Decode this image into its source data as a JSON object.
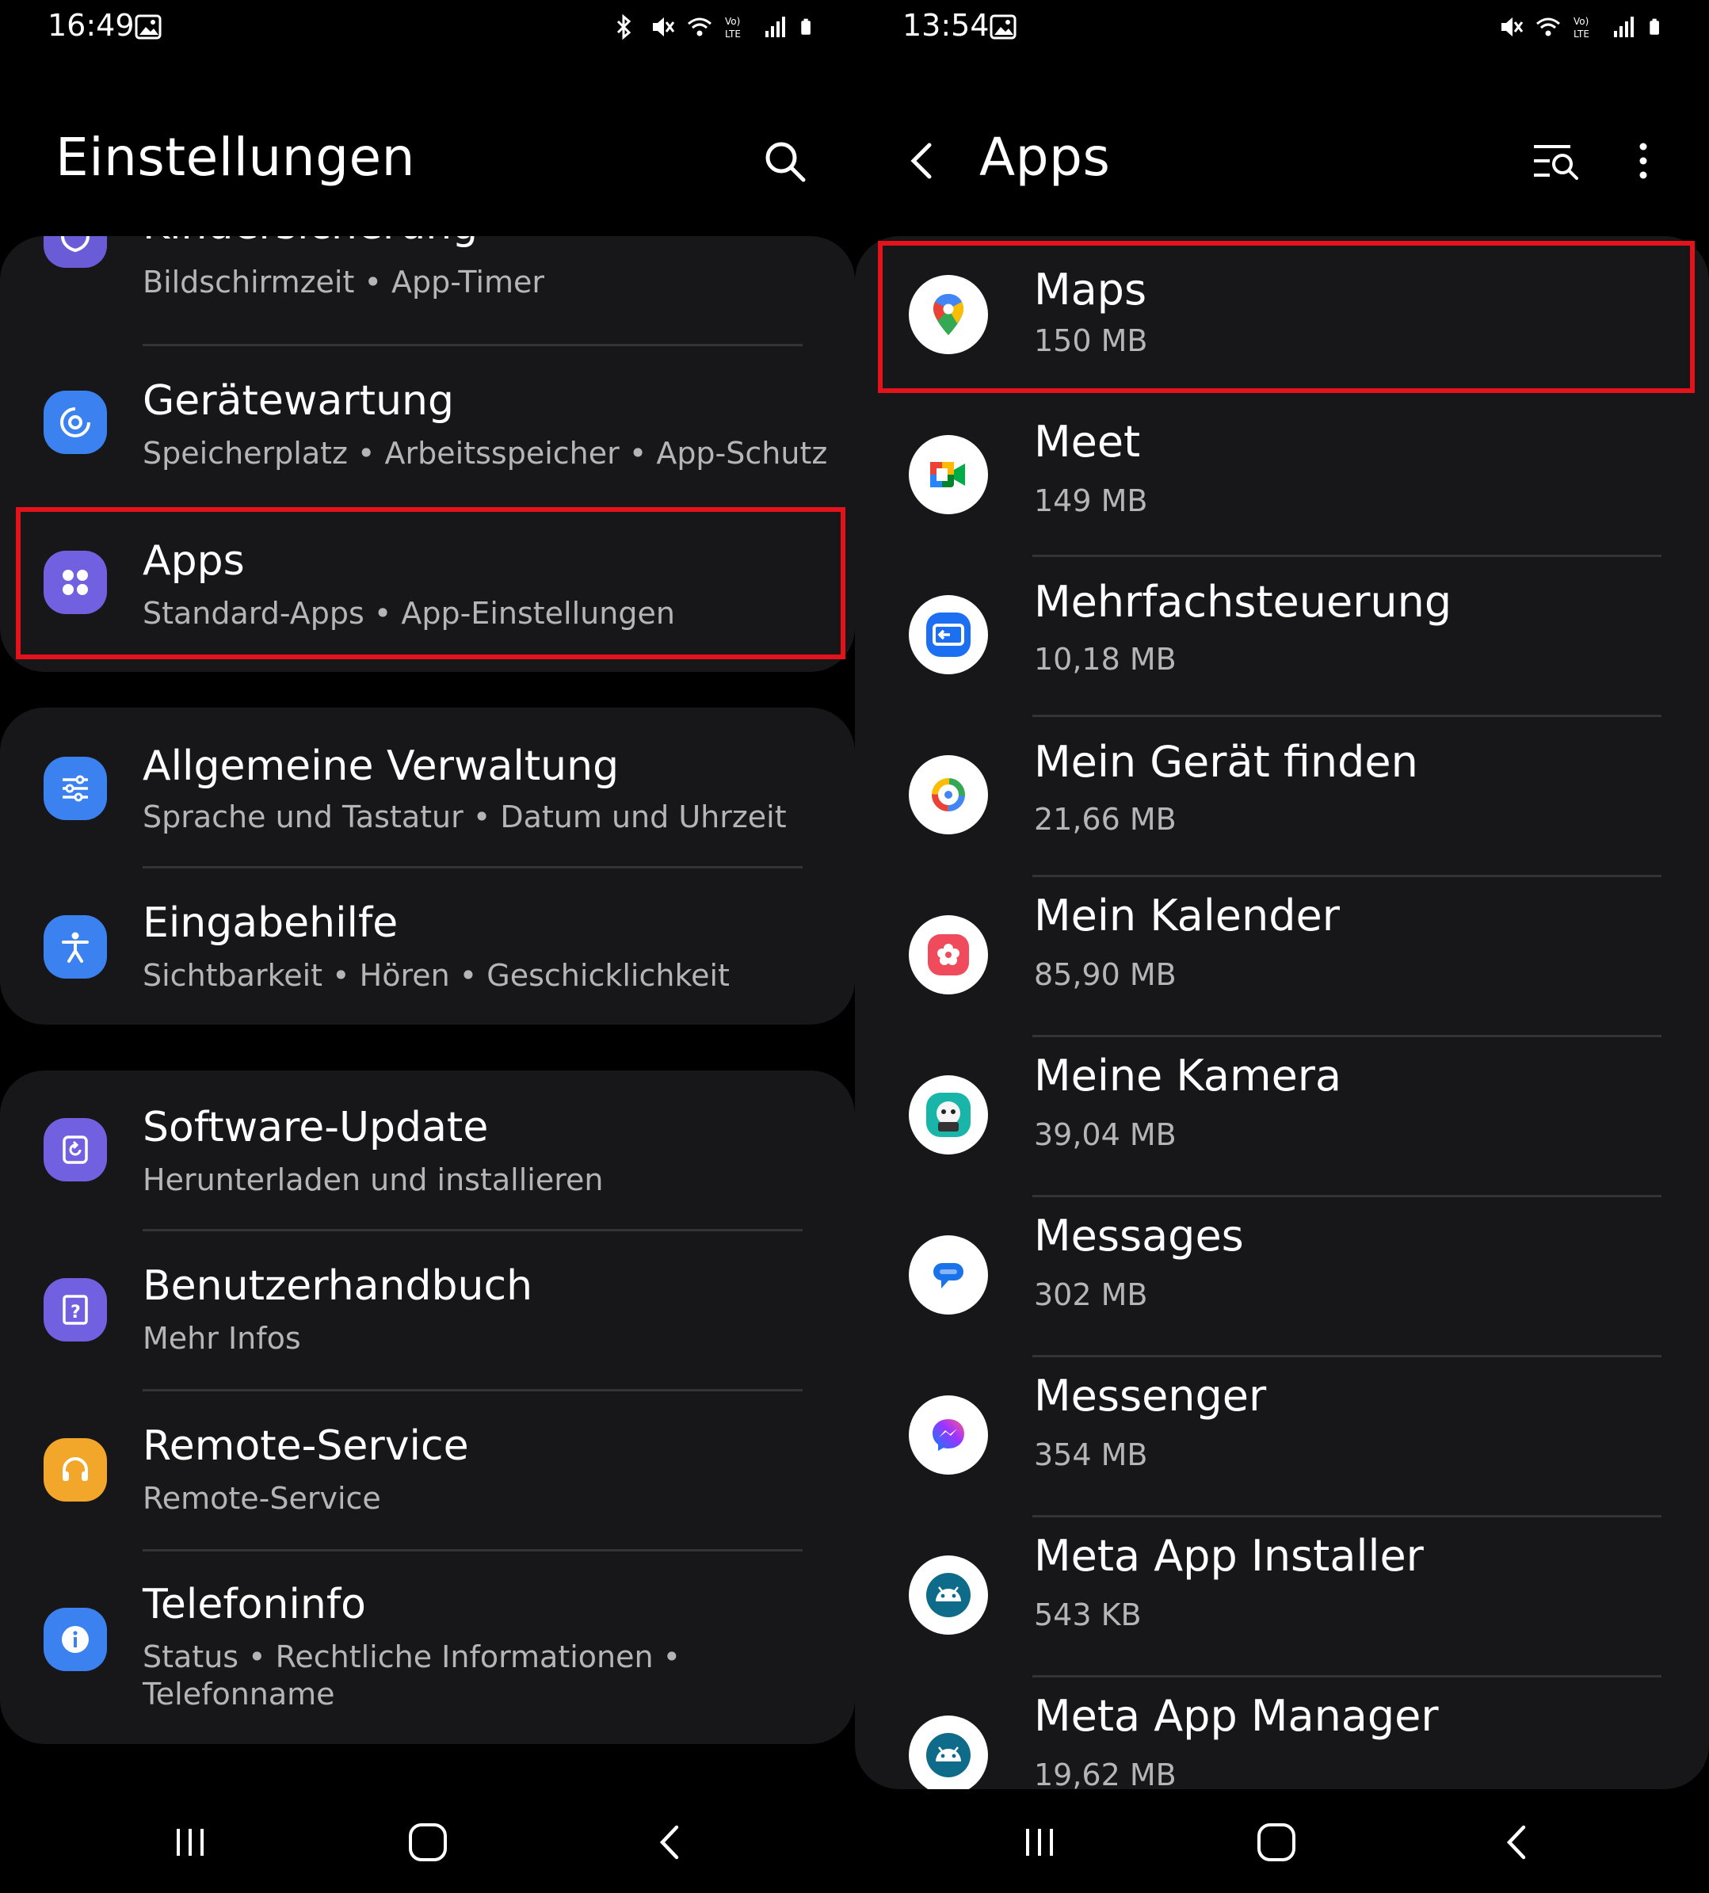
{
  "left": {
    "status": {
      "time": "16:49"
    },
    "title": "Einstellungen",
    "items": [
      {
        "title": "Kindersicherung",
        "subtitle": "Bildschirmzeit  •  App-Timer",
        "icon": "parental-icon",
        "color": "#6a5bd6"
      },
      {
        "title": "Gerätewartung",
        "subtitle": "Speicherplatz  •  Arbeitsspeicher  •  App-Schutz",
        "icon": "device-care-icon",
        "color": "#3b82f0"
      },
      {
        "title": "Apps",
        "subtitle": "Standard-Apps  •  App-Einstellungen",
        "icon": "apps-icon",
        "color": "#7160e0"
      },
      {
        "title": "Allgemeine Verwaltung",
        "subtitle": "Sprache und Tastatur  •  Datum und Uhrzeit",
        "icon": "sliders-icon",
        "color": "#3b82f0"
      },
      {
        "title": "Eingabehilfe",
        "subtitle": "Sichtbarkeit  •  Hören  •  Geschicklichkeit",
        "icon": "accessibility-icon",
        "color": "#3b82f0"
      },
      {
        "title": "Software-Update",
        "subtitle": "Herunterladen und installieren",
        "icon": "software-update-icon",
        "color": "#7160e0"
      },
      {
        "title": "Benutzerhandbuch",
        "subtitle": "Mehr Infos",
        "icon": "manual-icon",
        "color": "#7160e0"
      },
      {
        "title": "Remote-Service",
        "subtitle": "Remote-Service",
        "icon": "headset-icon",
        "color": "#f2a62a"
      },
      {
        "title": "Telefoninfo",
        "subtitle": "Status  •  Rechtliche Informationen  •",
        "subtitle2": "Telefonname",
        "icon": "info-icon",
        "color": "#3b82f0"
      }
    ]
  },
  "right": {
    "status": {
      "time": "13:54"
    },
    "title": "Apps",
    "apps": [
      {
        "name": "Maps",
        "size": "150 MB",
        "icon": "maps-icon"
      },
      {
        "name": "Meet",
        "size": "149 MB",
        "icon": "meet-icon"
      },
      {
        "name": "Mehrfachsteuerung",
        "size": "10,18 MB",
        "icon": "multi-control-icon"
      },
      {
        "name": "Mein Gerät finden",
        "size": "21,66 MB",
        "icon": "find-device-icon"
      },
      {
        "name": "Mein Kalender",
        "size": "85,90 MB",
        "icon": "calendar-icon"
      },
      {
        "name": "Meine Kamera",
        "size": "39,04 MB",
        "icon": "camera-app-icon"
      },
      {
        "name": "Messages",
        "size": "302 MB",
        "icon": "messages-icon"
      },
      {
        "name": "Messenger",
        "size": "354 MB",
        "icon": "messenger-icon"
      },
      {
        "name": "Meta App Installer",
        "size": "543 KB",
        "icon": "android-icon"
      },
      {
        "name": "Meta App Manager",
        "size": "19,62 MB",
        "icon": "android-icon"
      }
    ]
  },
  "colors": {
    "highlight": "#e3121b",
    "card": "#171719",
    "subtitle": "#b5b5b8"
  }
}
